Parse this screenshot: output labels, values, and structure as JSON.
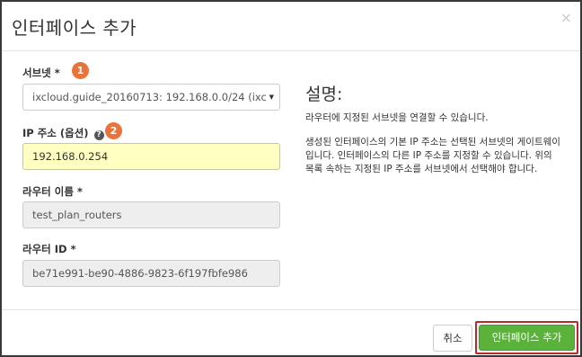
{
  "dialog": {
    "title": "인터페이스 추가",
    "close_glyph": "×"
  },
  "form": {
    "subnet": {
      "label": "서브넷",
      "required_mark": "*",
      "badge": "1",
      "selected_value": "ixcloud.guide_20160713: 192.168.0.0/24 (ixc"
    },
    "ip": {
      "label": "IP 주소 (옵션)",
      "badge": "2",
      "help_glyph": "?",
      "value": "192.168.0.254"
    },
    "router_name": {
      "label": "라우터 이름",
      "required_mark": "*",
      "value": "test_plan_routers"
    },
    "router_id": {
      "label": "라우터 ID",
      "required_mark": "*",
      "value": "be71e991-be90-4886-9823-6f197fbfe986"
    }
  },
  "description": {
    "title": "설명:",
    "paragraph1": "라우터에 지정된 서브넷을 연결할 수 있습니다.",
    "paragraph2": "생성된 인터페이스의 기본 IP 주소는 선택된 서브넷의 게이트웨이입니다. 인터페이스의 다른 IP 주소를 지정할 수 있습니다. 위의 목록 속하는 지정된 IP 주소를 서브넷에서 선택해야 합니다."
  },
  "footer": {
    "cancel_label": "취소",
    "submit_label": "인터페이스 추가"
  },
  "colors": {
    "badge": "#e8743b",
    "primary_button": "#5ab23b",
    "highlight_border": "#c0272d",
    "ip_input_bg": "#ffffc2"
  }
}
